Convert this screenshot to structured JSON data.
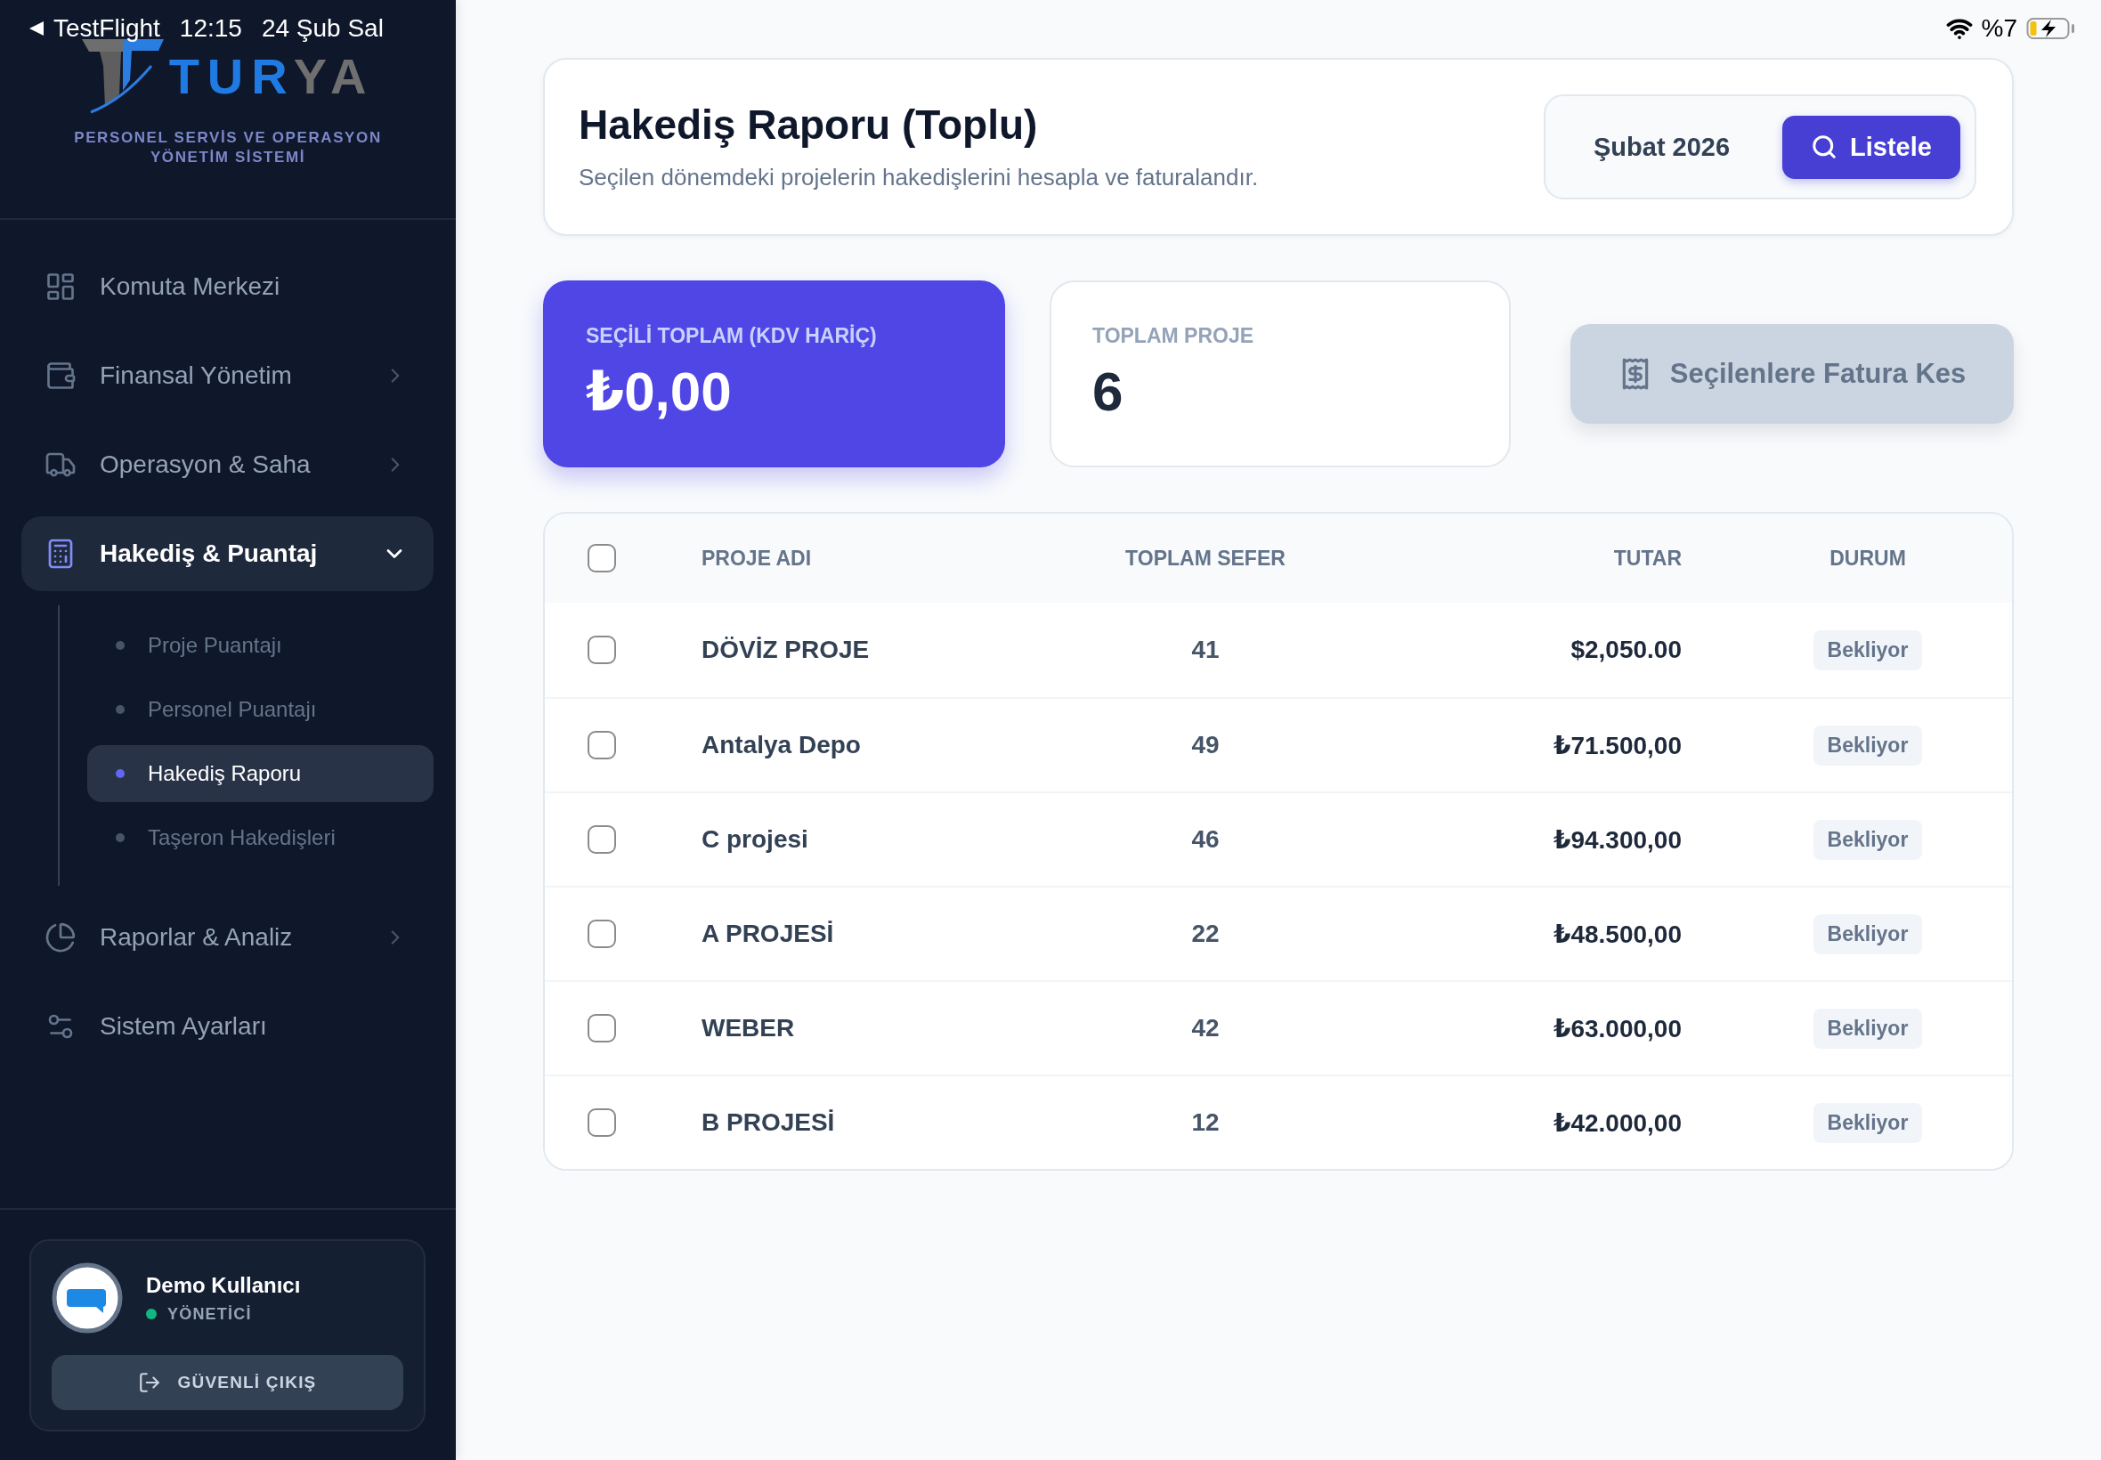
{
  "status_bar": {
    "back_label": "TestFlight",
    "time": "12:15",
    "date": "24 Şub Sal",
    "battery": "%7",
    "charging": true
  },
  "sidebar": {
    "logo": {
      "parts": [
        {
          "text": "TUR",
          "color": "#1f7be3"
        },
        {
          "text": "YA",
          "color": "#6f6f6f"
        }
      ],
      "tagline": "PERSONEL SERVİS VE OPERASYON YÖNETİM SİSTEMİ"
    },
    "items": [
      {
        "label": "Komuta Merkezi",
        "kind": "link",
        "selected": false
      },
      {
        "label": "Finansal Yönetim",
        "kind": "group",
        "selected": false,
        "expanded": false
      },
      {
        "label": "Operasyon & Saha",
        "kind": "group",
        "selected": false,
        "expanded": false
      },
      {
        "label": "Hakediş & Puantaj",
        "kind": "group",
        "selected": true,
        "expanded": true,
        "children": [
          {
            "label": "Proje Puantajı",
            "selected": false
          },
          {
            "label": "Personel Puantajı",
            "selected": false
          },
          {
            "label": "Hakediş Raporu",
            "selected": true
          },
          {
            "label": "Taşeron Hakedişleri",
            "selected": false
          }
        ]
      },
      {
        "label": "Raporlar & Analiz",
        "kind": "group",
        "selected": false,
        "expanded": false
      },
      {
        "label": "Sistem Ayarları",
        "kind": "link",
        "selected": false
      }
    ],
    "user": {
      "name": "Demo Kullanıcı",
      "role": "YÖNETİCİ",
      "online": true
    },
    "logout_button": "GÜVENLİ ÇIKIŞ"
  },
  "page_header": {
    "title": "Hakediş Raporu (Toplu)",
    "subtitle": "Seçilen dönemdeki projelerin hakedişlerini hesapla ve faturalandır.",
    "period": "Şubat 2026",
    "list_button": "Listele"
  },
  "stats": [
    {
      "kind": "highlight",
      "label": "SEÇİLİ TOPLAM (KDV HARİÇ)",
      "value": "₺0,00"
    },
    {
      "kind": "plain",
      "label": "TOPLAM PROJE",
      "value": "6"
    }
  ],
  "invoice_button": {
    "label": "Seçilenlere Fatura Kes",
    "disabled": true
  },
  "table": {
    "select_all_checked": false,
    "columns": [
      "PROJE ADI",
      "TOPLAM SEFER",
      "TUTAR",
      "DURUM"
    ],
    "rows": [
      {
        "checked": false,
        "project_name": "DÖVİZ PROJE",
        "total_trips": "41",
        "amount": "$2,050.00",
        "status": "Bekliyor"
      },
      {
        "checked": false,
        "project_name": "Antalya Depo",
        "total_trips": "49",
        "amount": "₺71.500,00",
        "status": "Bekliyor"
      },
      {
        "checked": false,
        "project_name": "C projesi",
        "total_trips": "46",
        "amount": "₺94.300,00",
        "status": "Bekliyor"
      },
      {
        "checked": false,
        "project_name": "A PROJESİ",
        "total_trips": "22",
        "amount": "₺48.500,00",
        "status": "Bekliyor"
      },
      {
        "checked": false,
        "project_name": "WEBER",
        "total_trips": "42",
        "amount": "₺63.000,00",
        "status": "Bekliyor"
      },
      {
        "checked": false,
        "project_name": "B PROJESİ",
        "total_trips": "12",
        "amount": "₺42.000,00",
        "status": "Bekliyor"
      }
    ]
  }
}
